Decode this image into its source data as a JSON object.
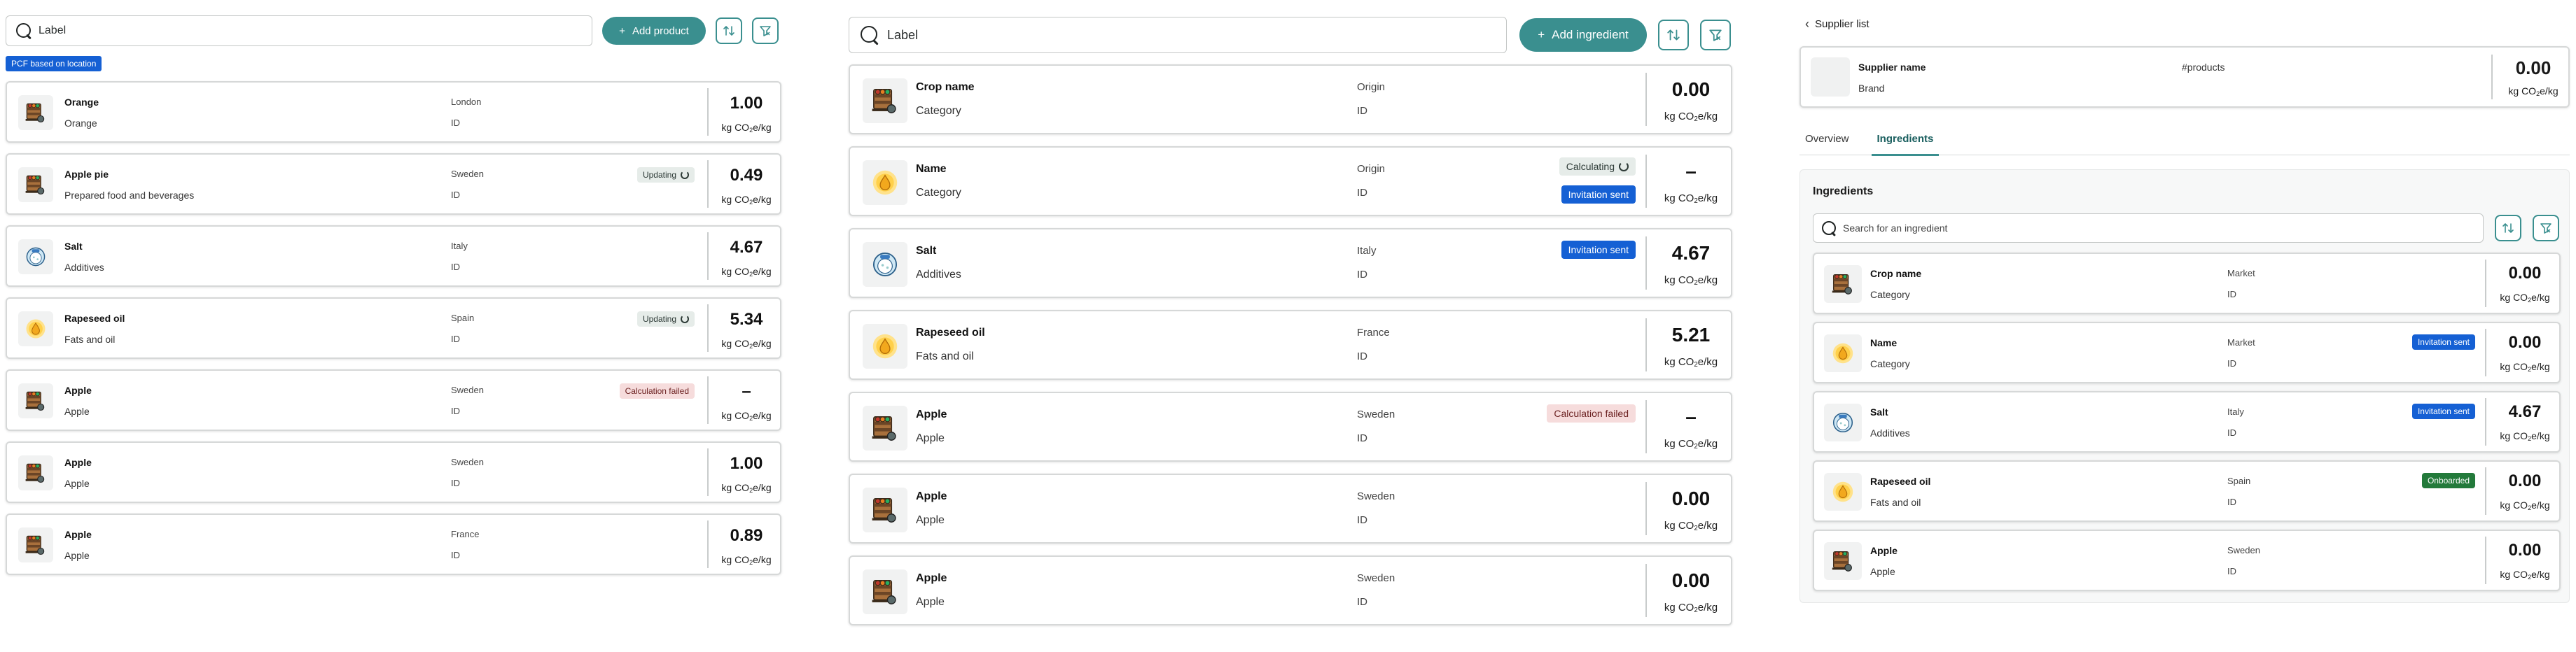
{
  "panel1": {
    "search_placeholder": "Label",
    "add_button": "Add product",
    "pcf_badge": "PCF based on location",
    "unit": {
      "a": "kg CO",
      "b": "2",
      "c": "e/kg"
    },
    "items": [
      {
        "name": "Orange",
        "category": "Orange",
        "location": "London",
        "id": "ID",
        "status": "",
        "status_type": "",
        "value": "1.00",
        "icon": "crate-icon"
      },
      {
        "name": "Apple pie",
        "category": "Prepared food and beverages",
        "location": "Sweden",
        "id": "ID",
        "status": "Updating",
        "status_type": "updating",
        "value": "0.49",
        "icon": "crate-icon"
      },
      {
        "name": "Salt",
        "category": "Additives",
        "location": "Italy",
        "id": "ID",
        "status": "",
        "status_type": "",
        "value": "4.67",
        "icon": "salt-icon"
      },
      {
        "name": "Rapeseed oil",
        "category": "Fats and oil",
        "location": "Spain",
        "id": "ID",
        "status": "Updating",
        "status_type": "updating",
        "value": "5.34",
        "icon": "oil-drop-icon"
      },
      {
        "name": "Apple",
        "category": "Apple",
        "location": "Sweden",
        "id": "ID",
        "status": "Calculation failed",
        "status_type": "failed",
        "value": "–",
        "icon": "crate-icon"
      },
      {
        "name": "Apple",
        "category": "Apple",
        "location": "Sweden",
        "id": "ID",
        "status": "",
        "status_type": "",
        "value": "1.00",
        "icon": "crate-icon"
      },
      {
        "name": "Apple",
        "category": "Apple",
        "location": "France",
        "id": "ID",
        "status": "",
        "status_type": "",
        "value": "0.89",
        "icon": "crate-icon"
      }
    ]
  },
  "panel2": {
    "search_placeholder": "Label",
    "add_button": "Add ingredient",
    "items": [
      {
        "name": "Crop name",
        "category": "Category",
        "location": "Origin",
        "id": "ID",
        "status": "",
        "status2": "",
        "value": "0.00",
        "icon": "crate-icon"
      },
      {
        "name": "Name",
        "category": "Category",
        "location": "Origin",
        "id": "ID",
        "status": "Calculating",
        "status2": "Invitation sent",
        "value": "–",
        "icon": "oil-drop-icon"
      },
      {
        "name": "Salt",
        "category": "Additives",
        "location": "Italy",
        "id": "ID",
        "status": "Invitation sent",
        "status_type": "invited",
        "status2": "",
        "value": "4.67",
        "icon": "salt-icon"
      },
      {
        "name": "Rapeseed oil",
        "category": "Fats and oil",
        "location": "France",
        "id": "ID",
        "status": "",
        "status2": "",
        "value": "5.21",
        "icon": "oil-drop-icon"
      },
      {
        "name": "Apple",
        "category": "Apple",
        "location": "Sweden",
        "id": "ID",
        "status": "Calculation failed",
        "status_type": "failed",
        "status2": "",
        "value": "–",
        "icon": "crate-icon"
      },
      {
        "name": "Apple",
        "category": "Apple",
        "location": "Sweden",
        "id": "ID",
        "status": "",
        "status2": "",
        "value": "0.00",
        "icon": "crate-icon"
      },
      {
        "name": "Apple",
        "category": "Apple",
        "location": "Sweden",
        "id": "ID",
        "status": "",
        "status2": "",
        "value": "0.00",
        "icon": "crate-icon"
      }
    ]
  },
  "panel3": {
    "back_label": "Supplier list",
    "supplier": {
      "name": "Supplier name",
      "brand": "Brand",
      "products": "#products",
      "value": "0.00"
    },
    "tabs": [
      "Overview",
      "Ingredients"
    ],
    "active_tab": "Ingredients",
    "ingredients_title": "Ingredients",
    "search_placeholder": "Search for an ingredient",
    "items": [
      {
        "name": "Crop name",
        "category": "Category",
        "location": "Market",
        "id": "ID",
        "status": "",
        "status_type": "",
        "value": "0.00",
        "icon": "crate-icon"
      },
      {
        "name": "Name",
        "category": "Category",
        "location": "Market",
        "id": "ID",
        "status": "Invitation sent",
        "status_type": "invited",
        "value": "0.00",
        "icon": "oil-drop-icon"
      },
      {
        "name": "Salt",
        "category": "Additives",
        "location": "Italy",
        "id": "ID",
        "status": "Invitation sent",
        "status_type": "invited",
        "value": "4.67",
        "icon": "salt-icon"
      },
      {
        "name": "Rapeseed oil",
        "category": "Fats and oil",
        "location": "Spain",
        "id": "ID",
        "status": "Onboarded",
        "status_type": "onboarded",
        "value": "0.00",
        "icon": "oil-drop-icon"
      },
      {
        "name": "Apple",
        "category": "Apple",
        "location": "Sweden",
        "id": "ID",
        "status": "",
        "status_type": "",
        "value": "0.00",
        "icon": "crate-icon"
      }
    ]
  },
  "colors": {
    "accent": "#3a8f8f",
    "invited": "#1560d4",
    "onboarded": "#237a3b",
    "failed_bg": "#f6dcdc",
    "updating_bg": "#e6ece9"
  }
}
